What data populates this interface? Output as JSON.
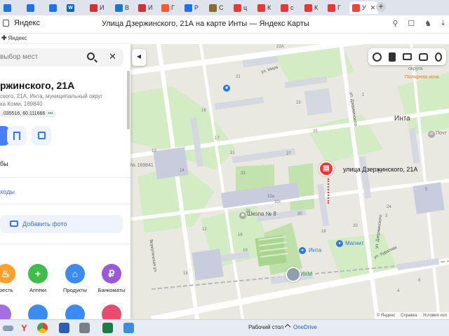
{
  "tabs": [
    {
      "icon_color": "#1a73e8",
      "icon_text": "",
      "label": "",
      "closable": false
    },
    {
      "icon_color": "#1a73e8",
      "icon_text": "",
      "label": "",
      "closable": false
    },
    {
      "icon_color": "#1a73e8",
      "icon_text": "",
      "label": "",
      "closable": false
    },
    {
      "icon_color": "#0066cc",
      "icon_text": "W",
      "label": "",
      "closable": false
    },
    {
      "icon_color": "#d32f2f",
      "icon_text": "",
      "label": "И",
      "closable": false
    },
    {
      "icon_color": "#1976d2",
      "icon_text": "",
      "label": "В",
      "closable": false
    },
    {
      "icon_color": "#d32f2f",
      "icon_text": "",
      "label": "И",
      "closable": false
    },
    {
      "icon_color": "#ff5722",
      "icon_text": "",
      "label": "Г",
      "closable": false
    },
    {
      "icon_color": "#1a73e8",
      "icon_text": "",
      "label": "Р",
      "closable": false
    },
    {
      "icon_color": "#8b6d2b",
      "icon_text": "",
      "label": "С",
      "closable": false
    },
    {
      "icon_color": "#e53935",
      "icon_text": "",
      "label": "ц",
      "closable": false
    },
    {
      "icon_color": "#e53935",
      "icon_text": "",
      "label": "К",
      "closable": false
    },
    {
      "icon_color": "#e53935",
      "icon_text": "",
      "label": "с",
      "closable": false
    },
    {
      "icon_color": "#e53935",
      "icon_text": "",
      "label": "К",
      "closable": false
    },
    {
      "icon_color": "#e53935",
      "icon_text": "",
      "label": "Г",
      "closable": false
    },
    {
      "icon_color": "#f44336",
      "icon_text": "",
      "label": "У",
      "closable": true,
      "active": true
    }
  ],
  "browser": {
    "brand": "Яндекс",
    "page_title": "Улица Дзержинского, 21А на карте Инты — Яндекс Карты"
  },
  "bookmarks": {
    "item": "Яндекс"
  },
  "panel": {
    "search_placeholder": "выбор мест",
    "title": "ржинского, 21А",
    "description_line1": "ского, 21А, Инта, муниципальный округ",
    "description_line2": "ка Коми, 169840",
    "coords": ".035516, 60.111666",
    "coords_more": "•••",
    "truncated_line": "бы",
    "entrances": "ходы",
    "add_photo": "Добавить фото",
    "categories": [
      {
        "label": "юесть",
        "color": "#ff9f2d",
        "icon": "fork-icon"
      },
      {
        "label": "Аптеки",
        "color": "#3fbf4a",
        "icon": "plus-icon"
      },
      {
        "label": "Продукты",
        "color": "#3d8bf2",
        "icon": "basket-icon"
      },
      {
        "label": "Банкоматы",
        "color": "#9b59d9",
        "icon": "ruble-icon"
      }
    ]
  },
  "map": {
    "pin_label": "улица Дзержинского, 21А",
    "city_label": "Инта",
    "poi_labels": {
      "school": "Школа № 8",
      "magnit": "Магнит",
      "inta": "Инта",
      "ikm": "ИКМ",
      "polar_night": "Полярная ночь",
      "okruga": "округа",
      "postal": "№ 169841",
      "pocht": "Почт"
    },
    "streets": {
      "mira": "ул. Мира",
      "dzerzh_top": "ул. Дзержинского",
      "dzerzh_bottom": "ул. Дзержинского",
      "kurtova": "ул. Куратова",
      "vorkut": "Воркутинская ул."
    },
    "house_numbers": [
      "22А",
      "21",
      "19",
      "23",
      "17",
      "25",
      "13",
      "14",
      "31",
      "27",
      "33",
      "32а",
      "32с",
      "28",
      "30",
      "12",
      "16",
      "10",
      "18",
      "20",
      "24",
      "22",
      "3",
      "5",
      "1",
      "6",
      "4",
      "15"
    ],
    "footer": {
      "brand": "© Яндекс",
      "help": "Справка",
      "terms": "Условия исп"
    }
  },
  "taskbar": {
    "desktop_label": "Рабочий стол",
    "onedrive": "OneDrive"
  },
  "colors": {
    "pin": "#f33333",
    "accent": "#3b70ee",
    "brand": "#fc3f1d"
  }
}
